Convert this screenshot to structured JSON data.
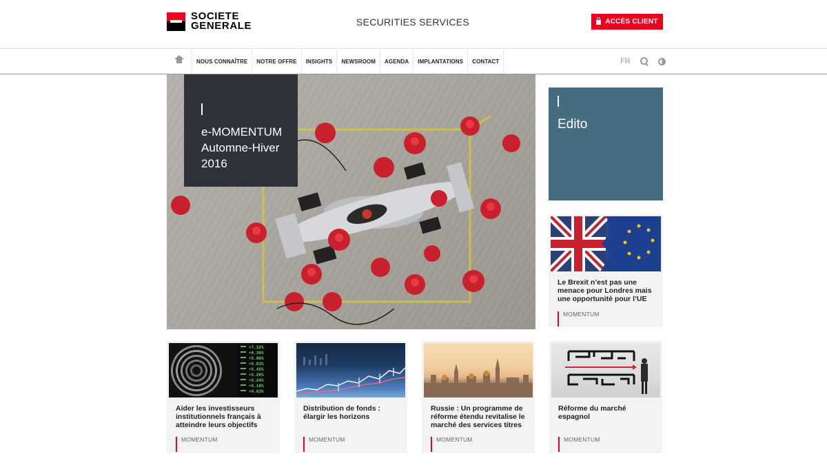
{
  "header": {
    "logo_line1": "SOCIETE",
    "logo_line2": "GENERALE",
    "service_title": "SECURITIES SERVICES",
    "client_button": "ACCÈS CLIENT"
  },
  "nav": {
    "items": [
      "NOUS CONNAÎTRE",
      "NOTRE OFFRE",
      "INSIGHTS",
      "NEWSROOM",
      "AGENDA",
      "IMPLANTATIONS",
      "CONTACT"
    ],
    "lang": "FR"
  },
  "hero": {
    "line1": "e-MOMENTUM",
    "line2": "Automne-Hiver",
    "line3": "2016"
  },
  "edito": {
    "title": "Edito"
  },
  "cards": [
    {
      "title": "Le Brexit n’est pas une menace pour Londres mais une opportunité pour l’UE",
      "tag": "MOMENTUM"
    },
    {
      "title": "Aider les investisseurs institutionnels français à atteindre leurs objectifs",
      "tag": "MOMENTUM"
    },
    {
      "title": "Distribution de fonds : élargir les horizons",
      "tag": "MOMENTUM"
    },
    {
      "title": "Russie : Un programme de réforme étendu revitalise le marché des services titres",
      "tag": "MOMENTUM"
    },
    {
      "title": "Réforme du marché espagnol",
      "tag": "MOMENTUM"
    }
  ],
  "thumb_ticker": [
    "+7.22%",
    "+6.36%",
    "+5.88%",
    "+5.81%",
    "+5.45%",
    "+5.26%",
    "+5.24%",
    "+5.18%",
    "+4.63%"
  ],
  "colors": {
    "brand_red": "#e9041e",
    "edito_blue": "#446e80",
    "hero_box": "#2e323a"
  }
}
